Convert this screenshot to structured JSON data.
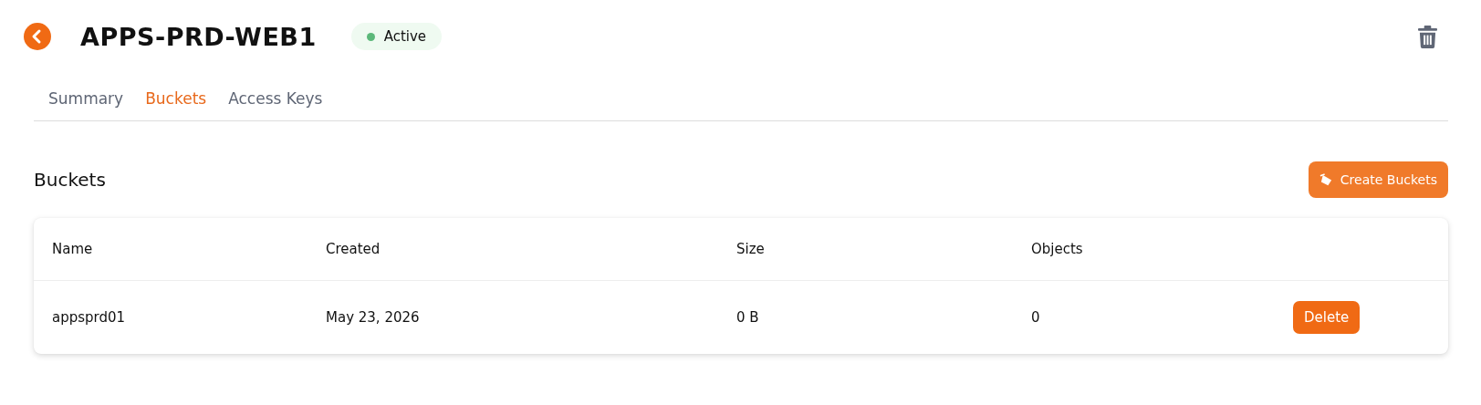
{
  "header": {
    "title": "APPS-PRD-WEB1",
    "status": {
      "label": "Active",
      "color": "#5cb87a"
    }
  },
  "tabs": [
    {
      "label": "Summary",
      "selected": false
    },
    {
      "label": "Buckets",
      "selected": true
    },
    {
      "label": "Access Keys",
      "selected": false
    }
  ],
  "section": {
    "title": "Buckets",
    "create_button": "Create Buckets"
  },
  "table": {
    "columns": [
      "Name",
      "Created",
      "Size",
      "Objects"
    ],
    "rows": [
      {
        "cells": [
          "appsprd01",
          "May 23, 2026",
          "0 B",
          "0"
        ],
        "action": "Delete"
      }
    ]
  }
}
